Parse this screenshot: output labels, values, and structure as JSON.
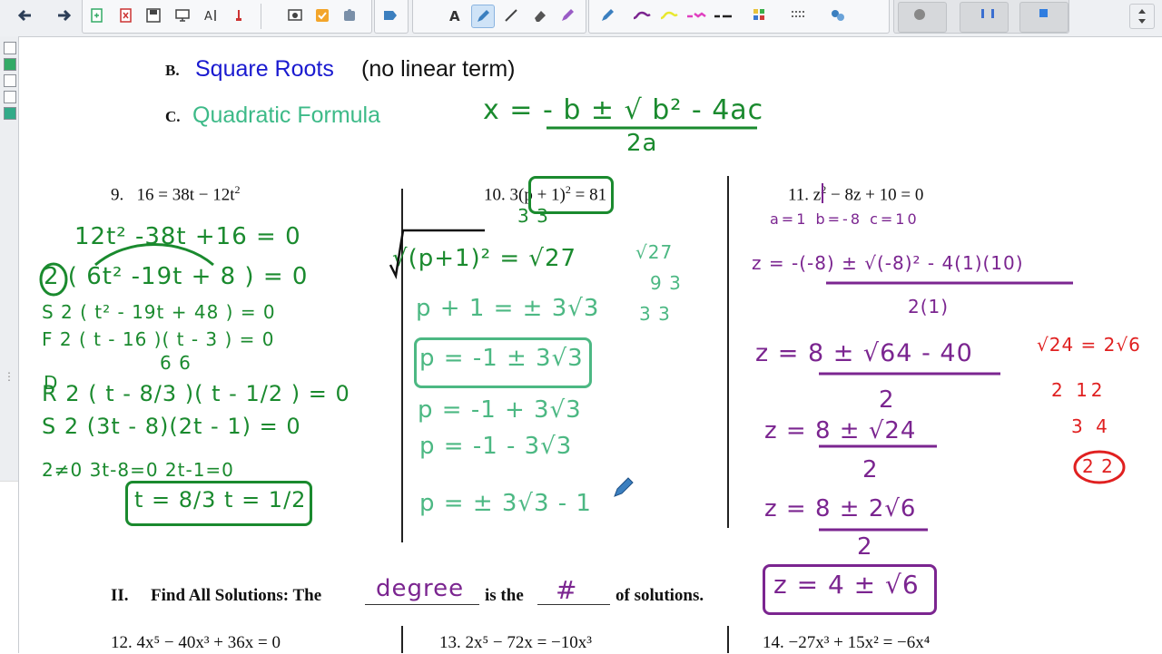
{
  "toolbar": {
    "back_icon": "arrow-left-icon",
    "forward_icon": "arrow-right-icon",
    "tools": [
      "page-add-icon",
      "page-delete-icon",
      "save-icon",
      "screen-shade-icon",
      "text-recognition-icon",
      "undo-icon",
      "capture-icon",
      "check-icon",
      "puzzle-icon",
      "shapes-icon",
      "font-icon",
      "pen-icon",
      "line-icon",
      "eraser-icon",
      "highlighter-icon",
      "pen-settings-icon",
      "fill-icon",
      "table-icon",
      "link-icon",
      "expand-icon"
    ],
    "line_colors": [
      "#7b2590",
      "#e8e830",
      "#e040c0",
      "#222222"
    ],
    "accent": "#cfe3f7"
  },
  "worksheet": {
    "section_b_letter": "B.",
    "section_b_title": "Square Roots",
    "section_b_rest": "(no linear term)",
    "section_c_letter": "C.",
    "section_c_title": "Quadratic Formula",
    "blue": "#1a1ad0",
    "teal": "#3dba88",
    "formula_numerator": "x = - b ± √ b² - 4ac",
    "formula_denominator": "2a",
    "p9_num": "9.",
    "p9_eq": "16 = 38t − 12t",
    "p9_exp": "2",
    "p10_num": "10.",
    "p10_eq": "3(p + 1)",
    "p10_exp": "2",
    "p10_rhs": "= 81",
    "p11_num": "11.",
    "p11_eq": "z",
    "p11_exp": "2",
    "p11_rest": " − 8z + 10 = 0",
    "section2_label": "II.",
    "section2_text_a": "Find All Solutions:  The",
    "section2_text_b": "is the",
    "section2_text_c": "of solutions.",
    "section2_blank1": "degree",
    "section2_blank2": "#",
    "p12": "12. 4x⁵ − 40x³ + 36x = 0",
    "p13": "13.  2x⁵ − 72x = −10x³",
    "p14": "14.  −27x³ + 15x² = −6x⁴"
  },
  "annotations": {
    "col1": [
      "12t² -38t +16 = 0",
      "2 ( 6t² -19t + 8 ) = 0",
      "S  2 ( t² - 19t + 48 ) = 0",
      "F  2 ( t - 16 )( t - 3 ) = 0",
      "6          6",
      "D",
      "R  2 ( t - 8/3 )( t - 1/2 ) = 0",
      "S  2 (3t - 8)(2t - 1) = 0",
      "2≠0    3t-8=0    2t-1=0",
      "t = 8/3     t = 1/2"
    ],
    "col2": [
      "√(p+1)² = √27",
      "3          3",
      "p + 1 = ± 3√3",
      "p = -1 ± 3√3",
      "p = -1 + 3√3",
      "p = -1 - 3√3",
      "p = ± 3√3  - 1",
      "√27",
      "9  3",
      "3 3"
    ],
    "col3": [
      "a=1    b=-8    c=10",
      "z = -(-8) ± √(-8)² - 4(1)(10)",
      "2(1)",
      "z = 8 ± √64 - 40",
      "2",
      "z = 8 ± √24",
      "2",
      "z = 8 ± 2√6",
      "2",
      "z = 4 ± √6"
    ],
    "side_red": [
      "√24 = 2√6",
      "2   12",
      "3   4",
      "2 2"
    ]
  }
}
